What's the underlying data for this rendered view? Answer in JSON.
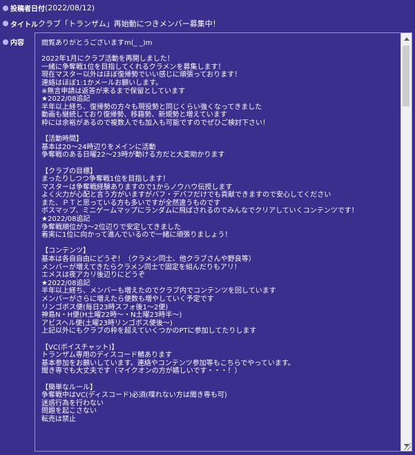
{
  "post": {
    "date_label": "投稿者日付",
    "date_value": "(2022/08/12)",
    "title_label": "タイトル",
    "title_value": "クラブ「トランザム」再始動につきメンバー募集中！",
    "body_label": "内容"
  },
  "content": {
    "lines": [
      "閲覧ありがとうございますm(_ _)m",
      "",
      "2022年1月にクラブ活動を再開しました！",
      "一緒に争奪戦1位を目指してくれるクラメンを募集します！",
      "現在マスター以外はほぼ復帰勢でいい感じに頑張っております！",
      "連絡はほぼ1:1かメールお願いします。",
      "※無言申請は返答が来るまで保留としています",
      "★2022/08追記",
      "半年以上経ち、復帰勢の方々も現役勢と同じくらい強くなってきました",
      "動画も継続しており復帰勢、移籍勢、新規勢と増えています",
      "枠には余裕があるので複数人でも加入も可能ですのでぜひご検討下さい！",
      "",
      "【活動時間】",
      "基本は20～24時辺りをメインに活動",
      "争奪戦のある日曜22～23時が動ける方だと大変助かります",
      "",
      "【クラブの目標】",
      "まったりしつつ争奪戦1位を目指します！",
      "マスターは争奪戦経験ありますので1からノウハウ伝授します",
      "よく火力が心配と言う方がいますがバフ・デバフだけでも貢献できますので安心してください",
      "また、ＰＴと思っている方も多いですが全然違うものです",
      "ボスマップ、ミニゲームマップにランダムに飛ばされるのでみんなでクリアしていくコンテンツです！",
      "★2022/08追記",
      "争奪戦順位が3～2位辺りで安定してきました",
      "着実に1位に向かって進んでいるので一緒に頑張りましょう！",
      "",
      "【コンテンツ】",
      "基本は各自自由にどうぞ！（クラメン同士、他クラブさんや野良等）",
      "メンバーが増えてきたらクラメン同士で固定を組んだりもアリ！",
      "エメスは夜アカリ後辺りにどうぞ",
      "★2022/08追記",
      "半年以上経ち、メンバーも増えたのでクラブ内でコンテンツを回しています",
      "メンバーがさらに増えたら便数も増やしていく予定です",
      "リンゴボス便(毎日23時スフォ後1～2便)",
      "神島N・H便(H土曜22時～・N土曜23時半～)",
      "アビスヘル便(土曜23時リンゴボス便後～)",
      "上記以外にもクラブの枠を超えていくつかのPTに参加してたりします",
      "",
      "【VC(ボイスチャット)】",
      "トランザム専用のディスコード鯖あります",
      "基本参加をお願いしています。連絡やコンテンツ参加等もこちらでやっています。",
      "聞き専でも大丈夫です（マイクオンの方が嬉しいです・・・！）",
      "",
      "【簡単なルール】",
      "争奪戦中はVC(ディスコード)必須(喋れない方は聞き専も可)",
      "迷惑行為を行わない",
      "問題を起こさない",
      "転売は禁止"
    ]
  },
  "colors": {
    "background": "#3a2f8c",
    "text": "#ffffff",
    "border": "#9a94d6"
  }
}
